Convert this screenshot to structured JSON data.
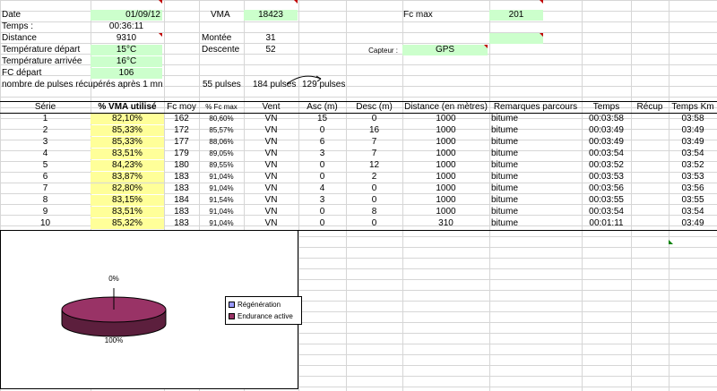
{
  "colors": {
    "green_cell": "#ccffcc",
    "yellow_cell": "#ffff99",
    "pie_slice": "#993366",
    "regen_swatch": "#9999ff"
  },
  "info": {
    "date_label": "Date",
    "date_value": "01/09/12",
    "temps_label": "Temps :",
    "temps_value": "00:36:11",
    "distance_label": "Distance",
    "distance_value": "9310",
    "temp_depart_label": "Température départ",
    "temp_depart_value": "15°C",
    "temp_arrivee_label": "Température arrivée",
    "temp_arrivee_value": "16°C",
    "fc_depart_label": "FC départ",
    "fc_depart_value": "106",
    "pulses_label": "nombre de pulses récupérés après 1 mn",
    "pulses_1": "55 pulses",
    "pulses_2": "184 pulses",
    "pulses_3": "129 pulses",
    "vma_label": "VMA",
    "vma_value": "18423",
    "montee_label": "Montée",
    "montee_value": "31",
    "descente_label": "Descente",
    "descente_value": "52",
    "fcmax_label": "Fc max",
    "fcmax_value": "201",
    "capteur_label": "Capteur :",
    "capteur_value": "GPS"
  },
  "table": {
    "headers": [
      "Série",
      "% VMA utilisé",
      "Fc moy",
      "% Fc max",
      "Vent",
      "Asc (m)",
      "Desc (m)",
      "Distance (en mètres)",
      "Remarques parcours",
      "Temps",
      "Récup",
      "Temps Km"
    ],
    "rows": [
      [
        "1",
        "82,10%",
        "162",
        "80,60%",
        "VN",
        "15",
        "0",
        "1000",
        "bitume",
        "00:03:58",
        "",
        "03:58"
      ],
      [
        "2",
        "85,33%",
        "172",
        "85,57%",
        "VN",
        "0",
        "16",
        "1000",
        "bitume",
        "00:03:49",
        "",
        "03:49"
      ],
      [
        "3",
        "85,33%",
        "177",
        "88,06%",
        "VN",
        "6",
        "7",
        "1000",
        "bitume",
        "00:03:49",
        "",
        "03:49"
      ],
      [
        "4",
        "83,51%",
        "179",
        "89,05%",
        "VN",
        "3",
        "7",
        "1000",
        "bitume",
        "00:03:54",
        "",
        "03:54"
      ],
      [
        "5",
        "84,23%",
        "180",
        "89,55%",
        "VN",
        "0",
        "12",
        "1000",
        "bitume",
        "00:03:52",
        "",
        "03:52"
      ],
      [
        "6",
        "83,87%",
        "183",
        "91,04%",
        "VN",
        "0",
        "2",
        "1000",
        "bitume",
        "00:03:53",
        "",
        "03:53"
      ],
      [
        "7",
        "82,80%",
        "183",
        "91,04%",
        "VN",
        "4",
        "0",
        "1000",
        "bitume",
        "00:03:56",
        "",
        "03:56"
      ],
      [
        "8",
        "83,15%",
        "184",
        "91,54%",
        "VN",
        "3",
        "0",
        "1000",
        "bitume",
        "00:03:55",
        "",
        "03:55"
      ],
      [
        "9",
        "83,51%",
        "183",
        "91,04%",
        "VN",
        "0",
        "8",
        "1000",
        "bitume",
        "00:03:54",
        "",
        "03:54"
      ],
      [
        "10",
        "85,32%",
        "183",
        "91,04%",
        "VN",
        "0",
        "0",
        "310",
        "bitume",
        "00:01:11",
        "",
        "03:49"
      ]
    ]
  },
  "chart": {
    "label_top": "0%",
    "label_bottom": "100%",
    "legend": [
      "Régénération",
      "Endurance active"
    ]
  },
  "chart_data": {
    "type": "pie",
    "categories": [
      "Régénération",
      "Endurance active"
    ],
    "values": [
      0,
      100
    ]
  }
}
